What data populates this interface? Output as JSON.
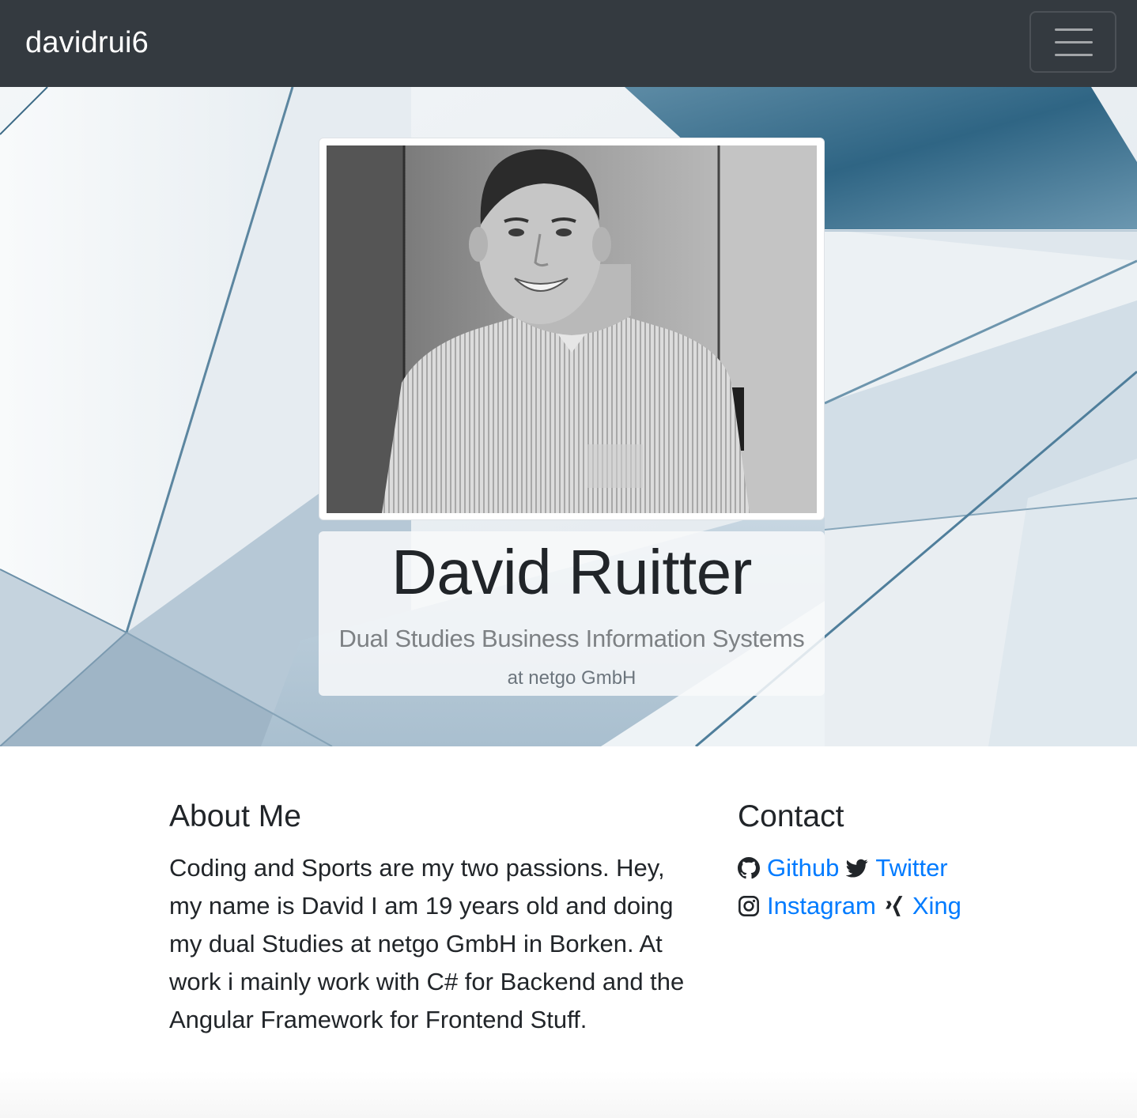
{
  "navbar": {
    "brand": "davidrui6",
    "toggler_icon": "hamburger-icon"
  },
  "hero": {
    "photo_alt": "Portrait photo",
    "name": "David Ruitter",
    "subtitle": "Dual Studies Business Information Systems",
    "company": "at netgo GmbH"
  },
  "about": {
    "heading": "About Me",
    "text": "Coding and Sports are my two passions. Hey, my name is David I am 19 years old and doing my dual Studies at netgo GmbH in Borken. At work i mainly work with C# for Backend and the Angular Framework for Frontend Stuff."
  },
  "contact": {
    "heading": "Contact",
    "links": [
      {
        "label": "Github",
        "icon": "github-icon"
      },
      {
        "label": "Twitter",
        "icon": "twitter-icon"
      },
      {
        "label": "Instagram",
        "icon": "instagram-icon"
      },
      {
        "label": "Xing",
        "icon": "xing-icon"
      }
    ]
  },
  "colors": {
    "navbar_bg": "#343a40",
    "link": "#007bff",
    "text": "#212529",
    "muted": "#6c757d"
  }
}
